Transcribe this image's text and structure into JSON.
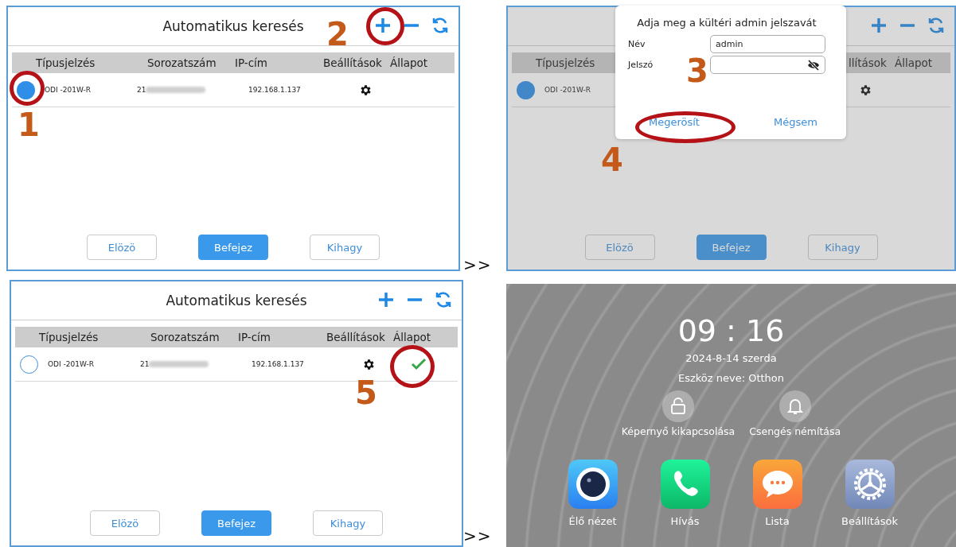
{
  "panels": [
    {
      "kind": "search",
      "title": "Automatikus keresés",
      "dimmed": false,
      "columns": [
        {
          "kind": "model",
          "label": "Típusjelzés"
        },
        {
          "kind": "serial",
          "label": "Sorozatszám"
        },
        {
          "kind": "ip",
          "label": "IP-cím"
        },
        {
          "kind": "settings",
          "label": "Beállítások"
        },
        {
          "kind": "status",
          "label": "Állapot"
        }
      ],
      "rows": [
        {
          "selected": true,
          "model": "ODI -201W-R",
          "serial": "21",
          "ip": "192.168.1.137",
          "connected": false
        }
      ],
      "buttons": [
        {
          "label": "Elözö",
          "primary": false
        },
        {
          "label": "Befejez",
          "primary": true
        },
        {
          "label": "Kihagy",
          "primary": false
        }
      ],
      "annotations": [
        {
          "number": "1"
        },
        {
          "number": "2"
        }
      ]
    },
    {
      "kind": "search",
      "dimmed": true,
      "columns": [
        {
          "kind": "model",
          "label": "Típusjelzés"
        },
        {
          "kind": "settings",
          "label": "llítások"
        },
        {
          "kind": "status",
          "label": "Állapot"
        }
      ],
      "rows": [
        {
          "selected": true,
          "model": "ODI -201W-R",
          "connected": false
        }
      ],
      "buttons": [
        {
          "label": "Elözö",
          "primary": false
        },
        {
          "label": "Befejez",
          "primary": true
        },
        {
          "label": "Kihagy",
          "primary": false
        }
      ],
      "dialog": {
        "title": "Adja meg a kültéri admin jelszavát",
        "fields": [
          {
            "label": "Név",
            "value": "admin",
            "kind": "text"
          },
          {
            "label": "Jelszó",
            "kind": "password"
          }
        ],
        "actions": [
          "Megerösít",
          "Mégsem"
        ]
      },
      "annotations": [
        {
          "number": "3"
        },
        {
          "number": "4"
        }
      ]
    },
    {
      "kind": "search",
      "title": "Automatikus keresés",
      "dimmed": false,
      "columns": [
        {
          "kind": "model",
          "label": "Típusjelzés"
        },
        {
          "kind": "serial",
          "label": "Sorozatszám"
        },
        {
          "kind": "ip",
          "label": "IP-cím"
        },
        {
          "kind": "settings",
          "label": "Beállítások"
        },
        {
          "kind": "status",
          "label": "Állapot"
        }
      ],
      "rows": [
        {
          "selected": false,
          "model": "ODI -201W-R",
          "serial": "21",
          "ip": "192.168.1.137",
          "connected": true
        }
      ],
      "buttons": [
        {
          "label": "Elözö",
          "primary": false
        },
        {
          "label": "Befejez",
          "primary": true
        },
        {
          "label": "Kihagy",
          "primary": false
        }
      ],
      "annotations": [
        {
          "number": "5"
        }
      ]
    },
    {
      "kind": "home",
      "time": "09 : 16",
      "date": "2024-8-14 szerda",
      "device_name": "Eszköz neve: Otthon",
      "quick_actions": [
        {
          "label": "Képernyő kikapcsolása",
          "kind": "lock"
        },
        {
          "label": "Csengés némítása",
          "kind": "bell"
        }
      ],
      "apps": [
        {
          "label": "Élő nézet",
          "kind": "camera"
        },
        {
          "label": "Hívás",
          "kind": "phone"
        },
        {
          "label": "Lista",
          "kind": "chat"
        },
        {
          "label": "Beállítások",
          "kind": "settings"
        }
      ]
    }
  ],
  "separators": [
    ">>",
    ">>"
  ]
}
